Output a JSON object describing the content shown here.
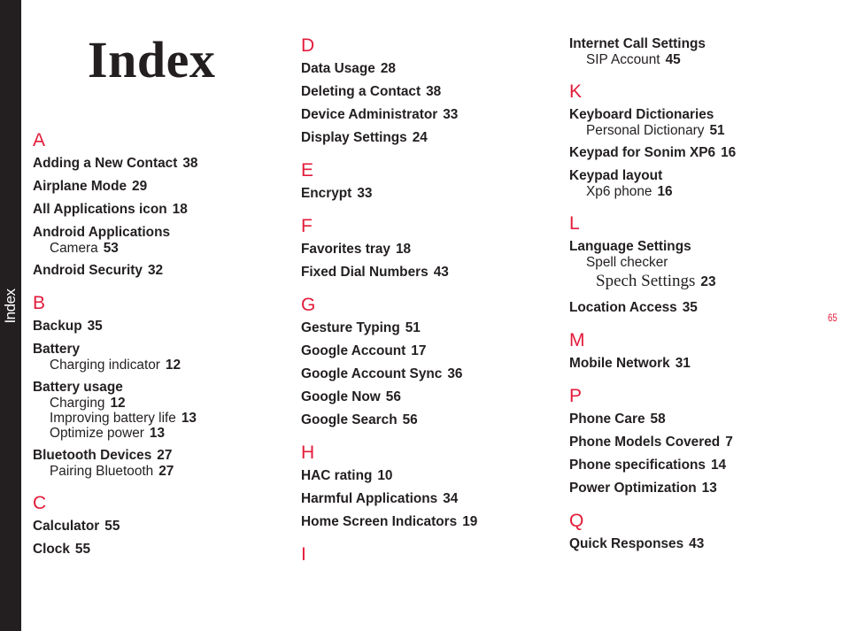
{
  "side_tab": {
    "label": "Index"
  },
  "title": "Index",
  "page_number": "65",
  "accent_color": "#e31b3a",
  "columns": [
    {
      "sections": [
        {
          "letter": "A",
          "entries": [
            {
              "term": "Adding a New Contact",
              "page": "38"
            },
            {
              "term": "Airplane Mode",
              "page": "29"
            },
            {
              "term": "All Applications icon",
              "page": "18"
            },
            {
              "term": "Android Applications",
              "subs": [
                {
                  "term": "Camera",
                  "page": "53"
                }
              ]
            },
            {
              "term": "Android Security",
              "page": "32"
            }
          ]
        },
        {
          "letter": "B",
          "entries": [
            {
              "term": "Backup",
              "page": "35"
            },
            {
              "term": "Battery",
              "subs": [
                {
                  "term": "Charging indicator",
                  "page": "12"
                }
              ]
            },
            {
              "term": "Battery usage",
              "subs": [
                {
                  "term": "Charging",
                  "page": "12"
                },
                {
                  "term": "Improving battery life",
                  "page": "13"
                },
                {
                  "term": "Optimize power",
                  "page": "13"
                }
              ]
            },
            {
              "term": "Bluetooth Devices",
              "page": "27",
              "subs": [
                {
                  "term": "Pairing Bluetooth",
                  "page": "27"
                }
              ]
            }
          ]
        },
        {
          "letter": "C",
          "entries": [
            {
              "term": "Calculator",
              "page": "55"
            },
            {
              "term": "Clock",
              "page": "55"
            }
          ]
        }
      ]
    },
    {
      "sections": [
        {
          "letter": "D",
          "entries": [
            {
              "term": "Data Usage",
              "page": "28"
            },
            {
              "term": "Deleting a Contact",
              "page": "38"
            },
            {
              "term": "Device Administrator",
              "page": "33"
            },
            {
              "term": "Display Settings",
              "page": "24"
            }
          ]
        },
        {
          "letter": "E",
          "entries": [
            {
              "term": "Encrypt",
              "page": "33"
            }
          ]
        },
        {
          "letter": "F",
          "entries": [
            {
              "term": "Favorites tray",
              "page": "18"
            },
            {
              "term": "Fixed Dial Numbers",
              "page": "43"
            }
          ]
        },
        {
          "letter": "G",
          "entries": [
            {
              "term": "Gesture Typing",
              "page": "51"
            },
            {
              "term": "Google Account",
              "page": "17"
            },
            {
              "term": "Google Account Sync",
              "page": "36"
            },
            {
              "term": "Google Now",
              "page": "56"
            },
            {
              "term": "Google Search",
              "page": "56"
            }
          ]
        },
        {
          "letter": "H",
          "entries": [
            {
              "term": "HAC rating",
              "page": "10"
            },
            {
              "term": "Harmful Applications",
              "page": "34"
            },
            {
              "term": "Home Screen Indicators",
              "page": "19"
            }
          ]
        },
        {
          "letter": "I",
          "entries": []
        }
      ]
    },
    {
      "sections": [
        {
          "letter": "",
          "entries": [
            {
              "term": "Internet Call Settings",
              "subs": [
                {
                  "term": "SIP Account",
                  "page": "45"
                }
              ]
            }
          ]
        },
        {
          "letter": "K",
          "entries": [
            {
              "term": "Keyboard Dictionaries",
              "subs": [
                {
                  "term": "Personal Dictionary",
                  "page": "51"
                }
              ]
            },
            {
              "term": "Keypad for Sonim XP6",
              "page": "16"
            },
            {
              "term": "Keypad layout",
              "subs": [
                {
                  "term": "Xp6 phone",
                  "page": "16"
                }
              ]
            }
          ]
        },
        {
          "letter": "L",
          "entries": [
            {
              "term": "Language Settings",
              "subs": [
                {
                  "term": "Spell checker",
                  "page": ""
                },
                {
                  "term": "Spech Settings",
                  "page": "23",
                  "serif": true
                }
              ]
            },
            {
              "term": "Location Access",
              "page": "35"
            }
          ]
        },
        {
          "letter": "M",
          "entries": [
            {
              "term": "Mobile Network",
              "page": "31"
            }
          ]
        },
        {
          "letter": "P",
          "entries": [
            {
              "term": "Phone Care",
              "page": "58"
            },
            {
              "term": "Phone Models Covered",
              "page": "7"
            },
            {
              "term": "Phone specifications",
              "page": "14"
            },
            {
              "term": "Power Optimization",
              "page": "13"
            }
          ]
        },
        {
          "letter": "Q",
          "entries": [
            {
              "term": "Quick Responses",
              "page": "43"
            }
          ]
        }
      ]
    }
  ]
}
